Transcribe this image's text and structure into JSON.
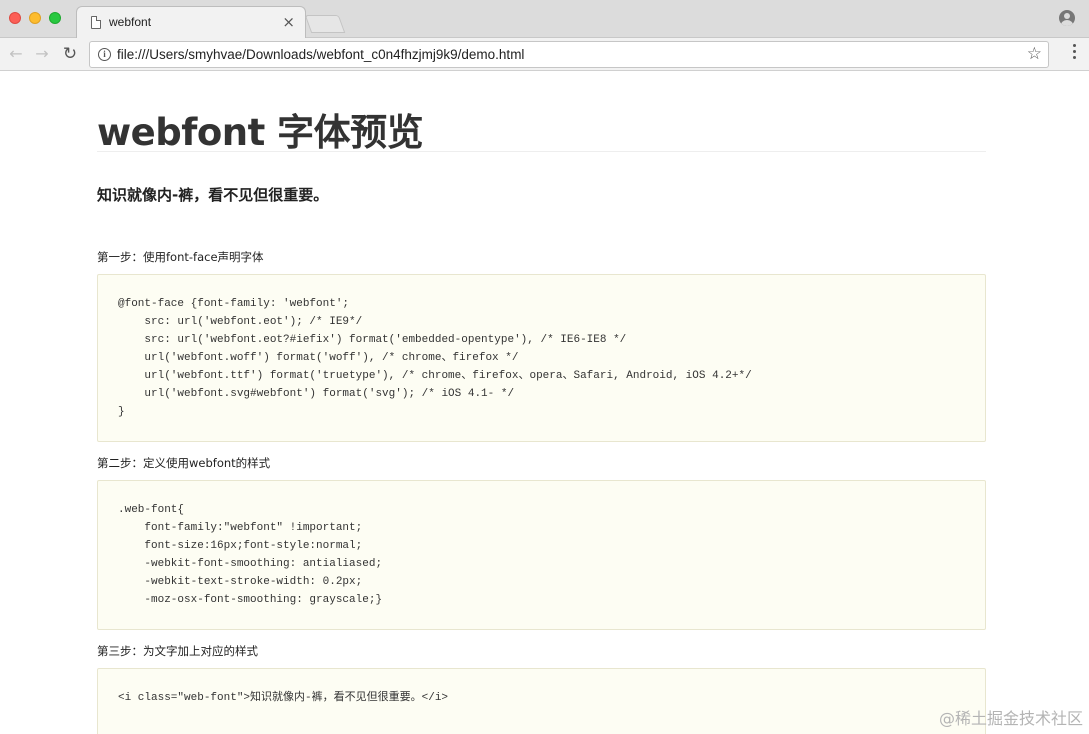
{
  "browser": {
    "tab_title": "webfont",
    "tab_close": "×",
    "url": "file:///Users/smyhvae/Downloads/webfont_c0n4fhzjmj9k9/demo.html",
    "back_glyph": "←",
    "forward_glyph": "→",
    "reload_glyph": "↻",
    "bookmark_glyph": "☆",
    "info_glyph": "i",
    "icons": [
      "file-icon",
      "close-icon",
      "profile-icon",
      "back-icon",
      "forward-icon",
      "reload-icon",
      "info-icon",
      "star-icon",
      "menu-icon"
    ]
  },
  "page": {
    "title": "webfont 字体预览",
    "subtitle": "知识就像内-裤，看不见但很重要。",
    "steps": [
      {
        "label": "第一步：使用font-face声明字体",
        "code": [
          "@font-face {font-family: 'webfont';",
          "    src: url('webfont.eot'); /* IE9*/",
          "    src: url('webfont.eot?#iefix') format('embedded-opentype'), /* IE6-IE8 */",
          "    url('webfont.woff') format('woff'), /* chrome、firefox */",
          "    url('webfont.ttf') format('truetype'), /* chrome、firefox、opera、Safari, Android, iOS 4.2+*/",
          "    url('webfont.svg#webfont') format('svg'); /* iOS 4.1- */",
          "}"
        ]
      },
      {
        "label": "第二步：定义使用webfont的样式",
        "code": [
          ".web-font{",
          "    font-family:\"webfont\" !important;",
          "    font-size:16px;font-style:normal;",
          "    -webkit-font-smoothing: antialiased;",
          "    -webkit-text-stroke-width: 0.2px;",
          "    -moz-osx-font-smoothing: grayscale;}"
        ]
      },
      {
        "label": "第三步：为文字加上对应的样式",
        "code": [
          "<i class=\"web-font\">知识就像内-裤，看不见但很重要。</i>"
        ]
      }
    ]
  },
  "watermark": "@稀土掘金技术社区",
  "colors": {
    "code_background": "#fdfdf3",
    "code_border": "#e8e6cf",
    "heading_text": "#333333"
  }
}
